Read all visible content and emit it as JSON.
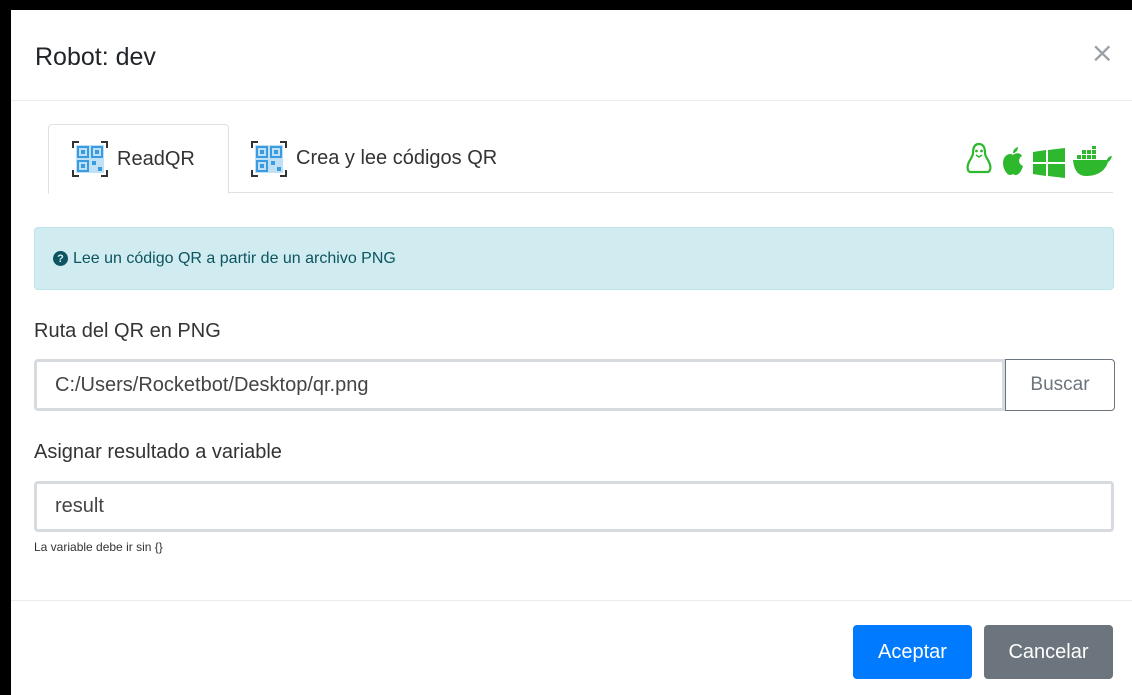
{
  "modal": {
    "title": "Robot: dev",
    "close_label": "×"
  },
  "tabs": [
    {
      "label": "ReadQR",
      "icon": "qr-code-icon"
    },
    {
      "label": "Crea y lee códigos QR",
      "icon": "qr-code-icon"
    }
  ],
  "os_icons": [
    "linux-icon",
    "apple-icon",
    "windows-icon",
    "docker-icon"
  ],
  "alert": {
    "icon": "question-circle-icon",
    "text": "Lee un código QR a partir de un archivo PNG"
  },
  "form": {
    "path_label": "Ruta del QR en PNG",
    "path_value": "C:/Users/Rocketbot/Desktop/qr.png",
    "browse_label": "Buscar",
    "var_label": "Asignar resultado a variable",
    "var_value": "result",
    "var_help": "La variable debe ir sin {}"
  },
  "footer": {
    "accept_label": "Aceptar",
    "cancel_label": "Cancelar"
  },
  "colors": {
    "primary": "#007bff",
    "secondary": "#6c757d",
    "os_green": "#2eb82e",
    "alert_bg": "#d1ecf1"
  }
}
